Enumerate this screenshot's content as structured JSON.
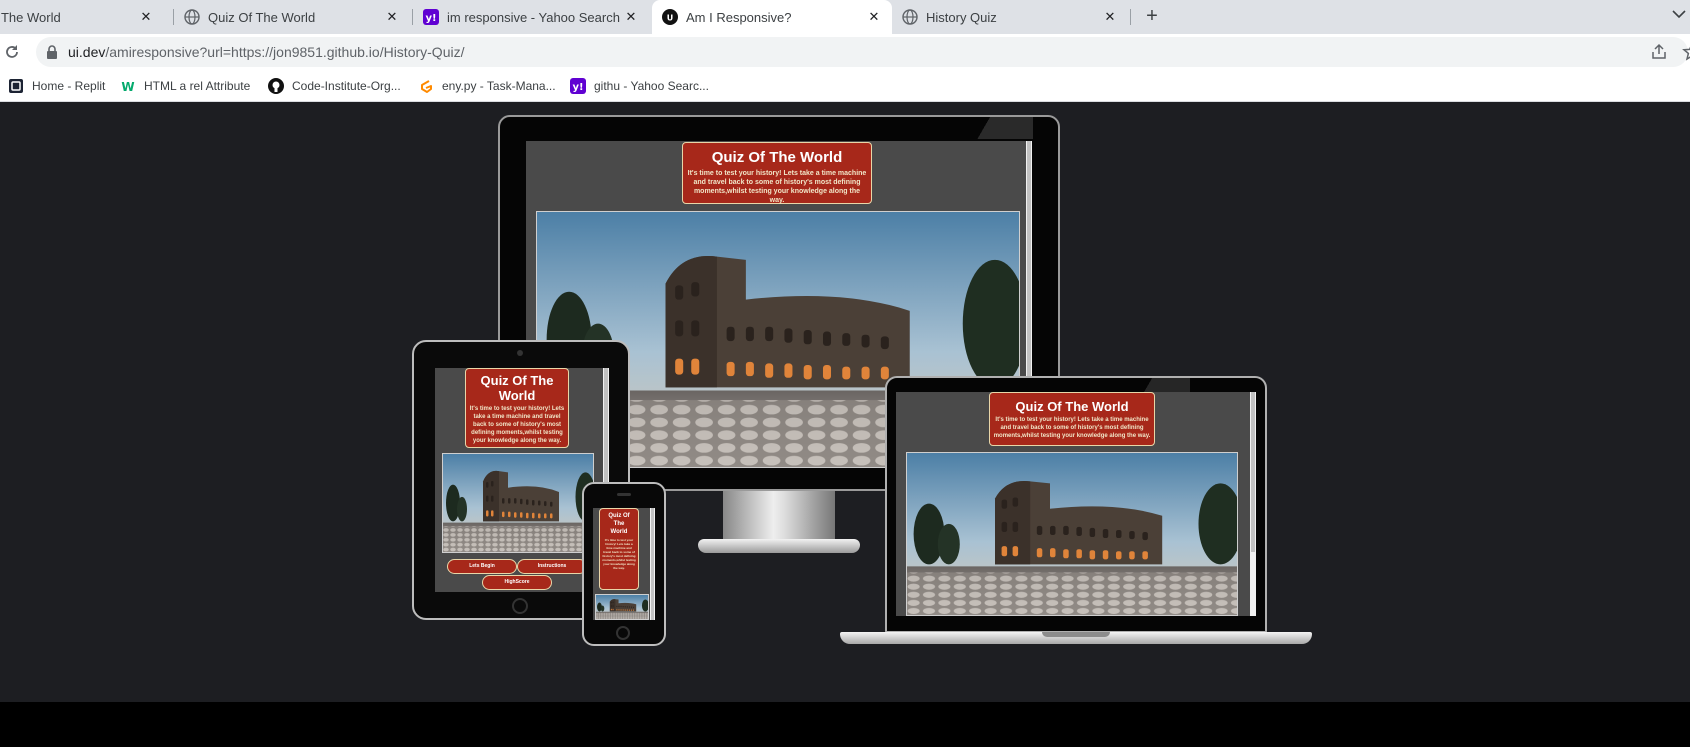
{
  "browser": {
    "tabs": [
      {
        "title": "f The World",
        "favicon": "globe-icon",
        "active": false
      },
      {
        "title": "Quiz Of The World",
        "favicon": "globe-icon",
        "active": false
      },
      {
        "title": "im responsive - Yahoo Search Re",
        "favicon": "yahoo-icon",
        "active": false
      },
      {
        "title": "Am I Responsive?",
        "favicon": "ui-dev-icon",
        "active": true
      },
      {
        "title": "History Quiz",
        "favicon": "globe-icon",
        "active": false
      }
    ],
    "close_glyph": "✕",
    "new_tab_glyph": "+",
    "url_host": "ui.dev",
    "url_path": "/amiresponsive?url=https://jon9851.github.io/History-Quiz/",
    "bookmarks": [
      {
        "label": "Home - Replit",
        "icon": "replit-icon"
      },
      {
        "label": "HTML a rel Attribute",
        "icon": "w3-icon"
      },
      {
        "label": "Code-Institute-Org...",
        "icon": "github-icon"
      },
      {
        "label": "eny.py - Task-Mana...",
        "icon": "gitpod-icon"
      },
      {
        "label": "githu - Yahoo Searc...",
        "icon": "yahoo-icon"
      }
    ]
  },
  "site": {
    "title": "Quiz Of The World",
    "title_phone_lines": [
      "Quiz Of",
      "The",
      "World"
    ],
    "title_tablet_lines": [
      "Quiz Of The",
      "World"
    ],
    "intro": "It's time to test your history! Lets take a time machine and travel back to some of history's most defining moments,whilst testing your knowledge along the way.",
    "buttons": {
      "begin": "Lets Begin",
      "instructions": "Instructions",
      "highscore": "HighScore"
    }
  },
  "colors": {
    "page_bg": "#1d1e22",
    "site_bg": "#4a4a4a",
    "hero_red": "#a7281a",
    "chrome_tabstrip": "#dee1e6"
  }
}
